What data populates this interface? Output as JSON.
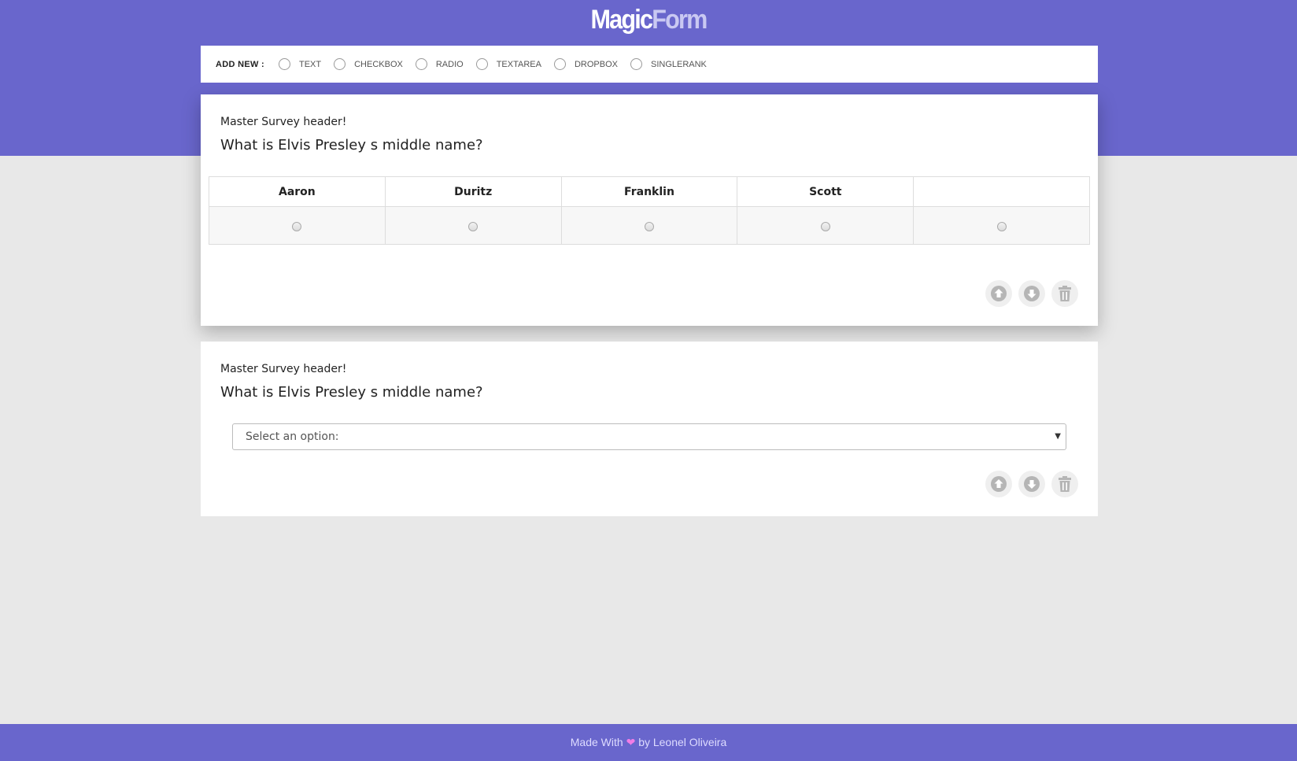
{
  "brand": {
    "part1": "Magic",
    "part2": "Form"
  },
  "toolbar": {
    "add_label": "ADD NEW :",
    "options": [
      "TEXT",
      "CHECKBOX",
      "RADIO",
      "TEXTAREA",
      "DROPBOX",
      "SINGLERANK"
    ]
  },
  "questions": [
    {
      "header": "Master Survey header!",
      "question": "What is Elvis Presley s middle name?",
      "type": "singlerank",
      "columns": [
        "Aaron",
        "Duritz",
        "Franklin",
        "Scott",
        ""
      ]
    },
    {
      "header": "Master Survey header!",
      "question": "What is Elvis Presley s middle name?",
      "type": "dropbox",
      "select_placeholder": "Select an option:"
    }
  ],
  "icons": {
    "move_up": "arrow-circle-up-icon",
    "move_down": "arrow-circle-down-icon",
    "delete": "trash-icon"
  },
  "colors": {
    "brand": "#6966cc",
    "heart": "#f27de6",
    "icon": "#b5b5b5"
  },
  "footer": {
    "made_with": "Made With",
    "heart": "❤",
    "by": "by Leonel Oliveira"
  }
}
